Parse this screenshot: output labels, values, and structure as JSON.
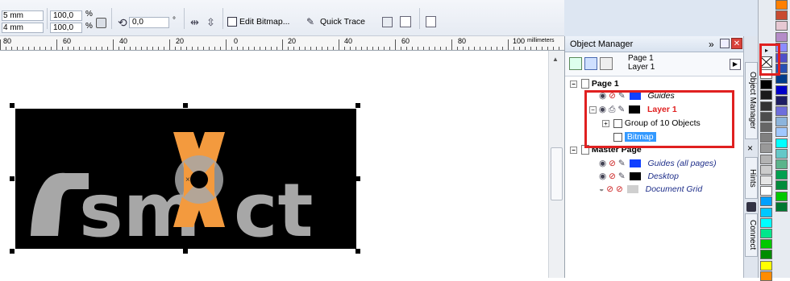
{
  "propbar": {
    "size_w": "5 mm",
    "size_h": "4 mm",
    "scale_x": "100,0",
    "scale_y": "100,0",
    "percent": "%",
    "rotation": "0,0",
    "degree": "°",
    "edit_bitmap_label": "Edit Bitmap...",
    "quick_trace_label": "Quick Trace"
  },
  "ruler": {
    "labels": [
      "80",
      "60",
      "40",
      "20",
      "0",
      "20",
      "40",
      "60",
      "80",
      "100"
    ],
    "unit": "millimeters"
  },
  "logo": {
    "text_left": "sm",
    "text_right": "ct",
    "colors": {
      "background": "#000000",
      "letters": "#a7a7a7",
      "accent": "#f39a3e"
    }
  },
  "object_manager": {
    "title": "Object Manager",
    "expand_glyph": "»",
    "page_name": "Page 1",
    "layer_name": "Layer 1",
    "tree": {
      "page1": "Page 1",
      "guides": "Guides",
      "layer1": "Layer 1",
      "group": "Group of 10 Objects",
      "bitmap": "Bitmap",
      "master_page": "Master Page",
      "guides_all": "Guides (all pages)",
      "desktop": "Desktop",
      "document_grid": "Document Grid"
    },
    "highlight_color": "#e02020"
  },
  "side_tabs": {
    "object_manager": "Object Manager",
    "hints": "Hints",
    "connect": "Connect",
    "close_glyph": "×"
  },
  "palette_colors": [
    "#ffffff",
    "#000000",
    "#1a1a1a",
    "#333333",
    "#4d4d4d",
    "#666666",
    "#808080",
    "#999999",
    "#b3b3b3",
    "#cccccc",
    "#e6e6e6",
    "#ffffff",
    "#00a0ff",
    "#00c8ff",
    "#00ffff",
    "#00e68c",
    "#00c800",
    "#008c00",
    "#ffff00",
    "#ff8c00"
  ],
  "palette_colors_right": [
    "#ff7f00",
    "#c84b31",
    "#e6c8d2",
    "#b48cc8",
    "#8c8cff",
    "#5050c8",
    "#2850b4",
    "#003c8c",
    "#0000c8",
    "#1e1e64",
    "#6e6edc",
    "#8cb4dc",
    "#a0c8ff",
    "#00ffff",
    "#64c8c8",
    "#5ab48c",
    "#00a050",
    "#008c3c",
    "#00c800",
    "#007830"
  ]
}
